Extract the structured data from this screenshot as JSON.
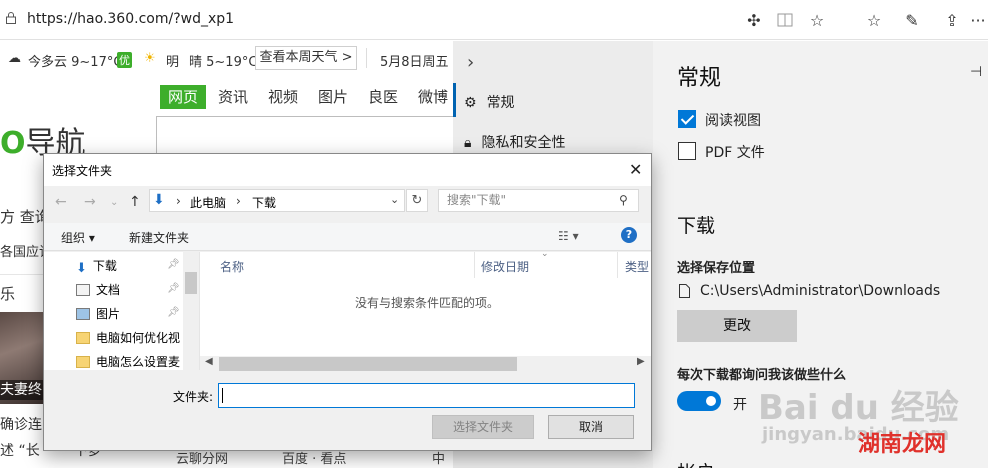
{
  "browser": {
    "url": "https://hao.360.com/?wd_xp1"
  },
  "page": {
    "weather_today": "今多云 9~17°C",
    "weather_badge": "优",
    "weather_tomorrow_day": "明",
    "weather_tomorrow": "晴 5~19°C",
    "weather_week_button": "查看本周天气 >",
    "date": "5月8日周五",
    "search_tabs": [
      "网页",
      "资讯",
      "视频",
      "图片",
      "良医",
      "微博"
    ],
    "logo_text": "导航",
    "left_frag_1": "方  查询",
    "left_frag_2": "各国应该",
    "left_frag_3": "乐",
    "photo_caption": "夫妻终",
    "left_frag_4": "确诊连",
    "left_frag_5": "述 “长",
    "left_frag_6": "一下梦",
    "bottom_link_1": "云聊分网",
    "bottom_link_2": "百度 · 看点",
    "bottom_link_3": "中"
  },
  "settings_nav": {
    "items": [
      {
        "label": "常规"
      },
      {
        "label": "隐私和安全性"
      }
    ]
  },
  "settings": {
    "title": "常规",
    "reading_view": "阅读视图",
    "pdf_files": "PDF 文件",
    "download_heading": "下载",
    "save_location_label": "选择保存位置",
    "save_location_path": "C:\\Users\\Administrator\\Downloads",
    "change_button": "更改",
    "ask_label": "每次下载都询问我该做些什么",
    "toggle_state": "开",
    "next_heading": "帐户"
  },
  "dialog": {
    "title": "选择文件夹",
    "path_root": "此电脑",
    "path_leaf": "下载",
    "search_placeholder": "搜索\"下载\"",
    "organize": "组织 ▾",
    "new_folder": "新建文件夹",
    "tree": [
      {
        "label": "下载",
        "icon": "download-arrow-icon"
      },
      {
        "label": "文档",
        "icon": "document-icon"
      },
      {
        "label": "图片",
        "icon": "picture-icon"
      },
      {
        "label": "电脑如何优化视",
        "icon": "folder-icon"
      },
      {
        "label": "电脑怎么设置麦",
        "icon": "folder-icon"
      }
    ],
    "columns": [
      "名称",
      "修改日期",
      "类型"
    ],
    "empty_message": "没有与搜索条件匹配的项。",
    "folder_label": "文件夹:",
    "folder_value": "",
    "select_button": "选择文件夹",
    "cancel_button": "取消"
  },
  "watermark": {
    "brand": "Bai du 经验",
    "url": "jingyan.baidu.com",
    "corner": "湖南龙网"
  },
  "colors": {
    "accent": "#0078d7",
    "brand_green": "#3dae2b"
  }
}
